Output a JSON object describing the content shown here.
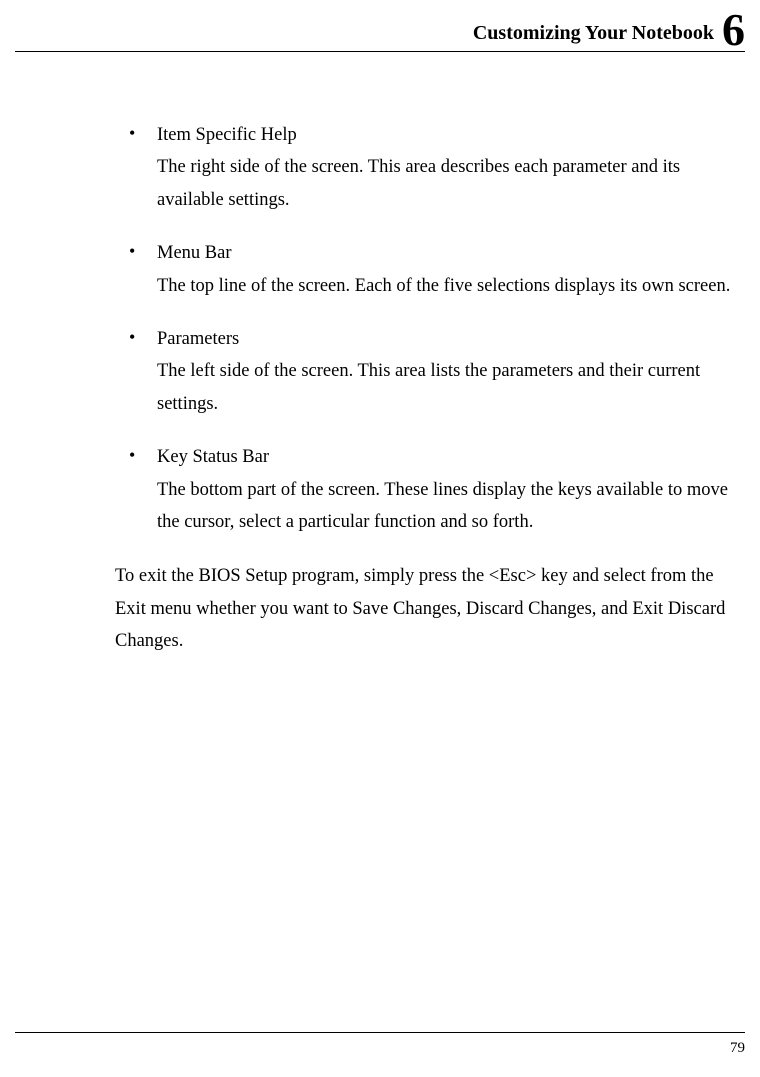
{
  "header": {
    "title": "Customizing Your Notebook",
    "chapter": "6"
  },
  "bullets": [
    {
      "title": "Item Specific Help",
      "description": "The right side of the screen. This area describes each parameter and its available settings."
    },
    {
      "title": "Menu Bar",
      "description": "The top line of the screen. Each of the five selections displays its own screen."
    },
    {
      "title": "Parameters",
      "description": "The left side of the screen. This area lists the parameters and their current settings."
    },
    {
      "title": "Key Status Bar",
      "description": "The bottom part of the screen. These lines display the keys available to move the cursor, select a particular function and so forth."
    }
  ],
  "paragraph": "To exit the BIOS Setup program, simply press the <Esc> key and select from the Exit menu whether you want to Save Changes, Discard Changes, and Exit Discard Changes.",
  "pageNumber": "79"
}
